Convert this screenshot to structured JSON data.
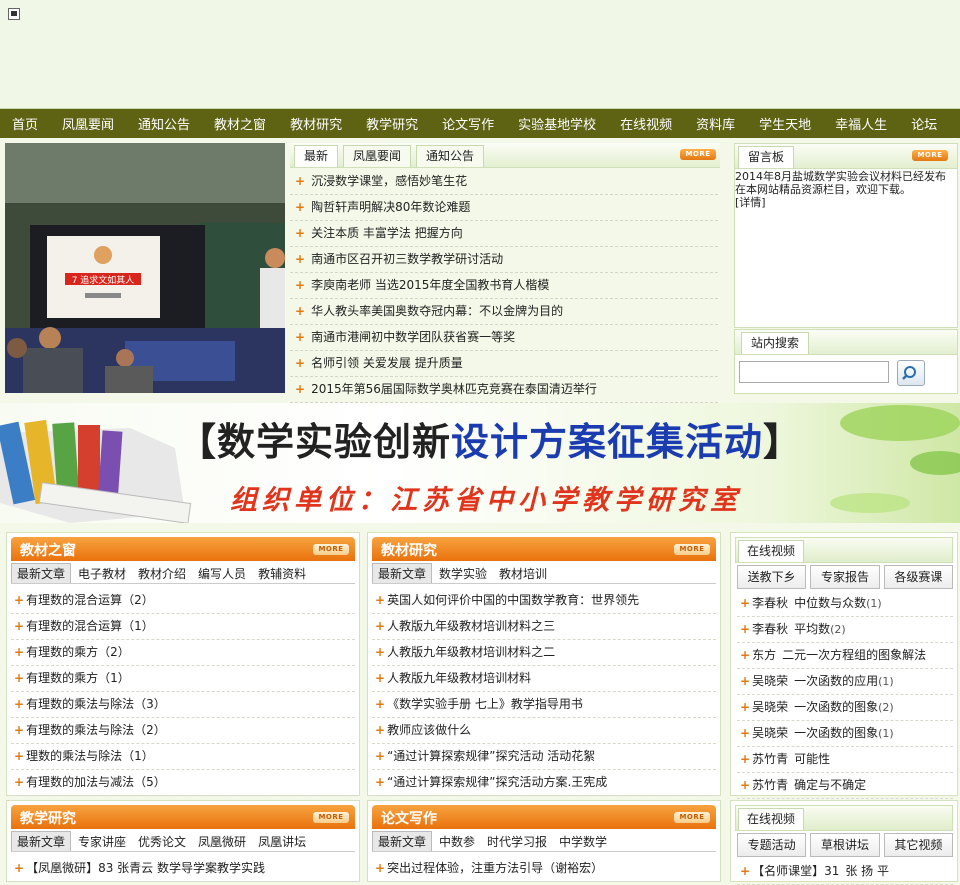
{
  "nav": [
    "首页",
    "凤凰要闻",
    "通知公告",
    "教材之窗",
    "教材研究",
    "教学研究",
    "论文写作",
    "实验基地学校",
    "在线视频",
    "资料库",
    "学生天地",
    "幸福人生",
    "论坛"
  ],
  "photo": {
    "slide_text": "7 追求文如其人"
  },
  "news": {
    "tabs": [
      "最新",
      "凤凰要闻",
      "通知公告"
    ],
    "more": "MORE",
    "items": [
      "沉浸数学课堂，感悟妙笔生花",
      "陶哲轩声明解决80年数论难题",
      "关注本质 丰富学法 把握方向",
      "南通市区召开初三数学教学研讨活动",
      "李庾南老师 当选2015年度全国教书育人楷模",
      "华人教头率美国奥数夺冠内幕：不以金牌为目的",
      "南通市港闸初中数学团队获省赛一等奖",
      "名师引领 关爱发展 提升质量",
      "2015年第56届国际数学奥林匹克竞赛在泰国清迈举行"
    ]
  },
  "message_board": {
    "title": "留言板",
    "more": "MORE",
    "text": "2014年8月盐城数学实验会议材料已经发布在本网站精品资源栏目，欢迎下载。",
    "details": "[详情]"
  },
  "site_search": {
    "title": "站内搜索",
    "placeholder": ""
  },
  "banner": {
    "title_open": "【",
    "title_red": "数学实验创新",
    "title_blue": "设计方案征集活动",
    "title_close": "】",
    "org": "组织单位：江苏省中小学教学研究室"
  },
  "panels": {
    "textbook_window": {
      "title": "教材之窗",
      "more": "MORE",
      "tabs": [
        "最新文章",
        "电子教材",
        "教材介绍",
        "编写人员",
        "教辅资料"
      ],
      "items": [
        "有理数的混合运算（2）",
        "有理数的混合运算（1）",
        "有理数的乘方（2）",
        "有理数的乘方（1）",
        "有理数的乘法与除法（3）",
        "有理数的乘法与除法（2）",
        "理数的乘法与除法（1）",
        "有理数的加法与减法（5）"
      ]
    },
    "textbook_research": {
      "title": "教材研究",
      "more": "MORE",
      "tabs": [
        "最新文章",
        "数学实验",
        "教材培训"
      ],
      "items": [
        "英国人如何评价中国的中国数学教育：世界领先",
        "人教版九年级教材培训材料之三",
        "人教版九年级教材培训材料之二",
        "人教版九年级教材培训材料",
        "《数学实验手册 七上》教学指导用书",
        "教师应该做什么",
        "“通过计算探索规律”探究活动 活动花絮",
        "“通过计算探索规律”探究活动方案.王宪成"
      ]
    },
    "teaching_research": {
      "title": "教学研究",
      "more": "MORE",
      "tabs": [
        "最新文章",
        "专家讲座",
        "优秀论文",
        "凤凰微研",
        "凤凰讲坛"
      ],
      "items": [
        "【凤凰微研】83 张青云 数学导学案教学实践"
      ]
    },
    "paper_writing": {
      "title": "论文写作",
      "more": "MORE",
      "tabs": [
        "最新文章",
        "中数参",
        "时代学习报",
        "中学数学"
      ],
      "items": [
        "突出过程体验，注重方法引导（谢裕宏）"
      ]
    },
    "video1": {
      "title": "在线视频",
      "buttons": [
        "送教下乡",
        "专家报告",
        "各级赛课"
      ],
      "items": [
        {
          "name": "李春秋",
          "title": "中位数与众数",
          "num": "(1)"
        },
        {
          "name": "李春秋",
          "title": "平均数",
          "num": "(2)"
        },
        {
          "name": "东方",
          "title": "二元一次方程组的图象解法",
          "num": ""
        },
        {
          "name": "吴晓荣",
          "title": "一次函数的应用",
          "num": "(1)"
        },
        {
          "name": "吴晓荣",
          "title": "一次函数的图象",
          "num": "(2)"
        },
        {
          "name": "吴晓荣",
          "title": "一次函数的图象",
          "num": "(1)"
        },
        {
          "name": "苏竹青",
          "title": "可能性",
          "num": ""
        },
        {
          "name": "苏竹青",
          "title": "确定与不确定",
          "num": ""
        }
      ]
    },
    "video2": {
      "title": "在线视频",
      "buttons": [
        "专题活动",
        "草根讲坛",
        "其它视频"
      ],
      "items": [
        {
          "name": "【名师课堂】31",
          "title": "张 扬 平",
          "num": ""
        }
      ]
    }
  }
}
